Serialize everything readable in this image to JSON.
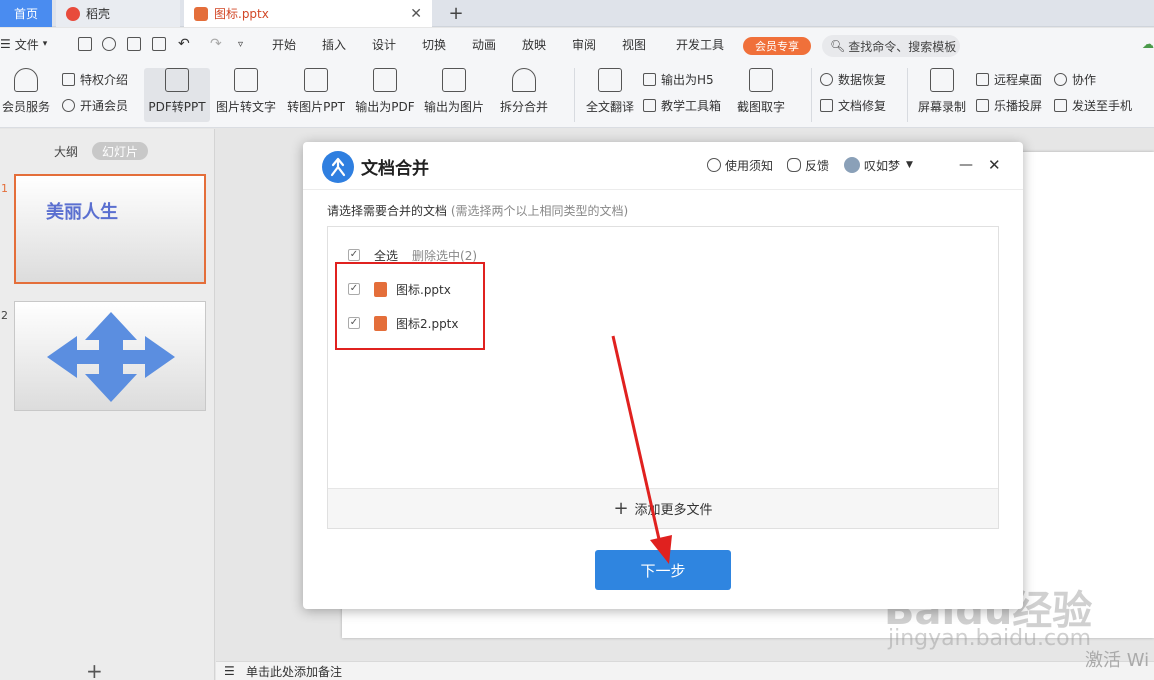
{
  "tabs": {
    "home": "首页",
    "daoke": "稻壳",
    "document": "图标.pptx"
  },
  "menu": {
    "file": "文件",
    "items": [
      "开始",
      "插入",
      "设计",
      "切换",
      "动画",
      "放映",
      "审阅",
      "视图",
      "开发工具"
    ],
    "vip": "会员专享",
    "search": "查找命令、搜索模板"
  },
  "ribbon": {
    "member_service": "会员服务",
    "privilege": "特权介绍",
    "open_member": "开通会员",
    "pdf_to_ppt": "PDF转PPT",
    "img_to_text": "图片转文字",
    "to_img_ppt": "转图片PPT",
    "export_pdf": "输出为PDF",
    "export_img": "输出为图片",
    "split_merge": "拆分合并",
    "full_translate": "全文翻译",
    "export_h5": "输出为H5",
    "teach_tools": "教学工具箱",
    "screenshot_text": "截图取字",
    "data_recover": "数据恢复",
    "doc_repair": "文档修复",
    "screen_record": "屏幕录制",
    "remote_desktop": "远程桌面",
    "cast": "乐播投屏",
    "collab": "协作",
    "send_phone": "发送至手机"
  },
  "left_panel": {
    "outline_tab": "大纲",
    "slides_tab": "幻灯片",
    "slides": [
      {
        "num": "1",
        "title": "美丽人生"
      },
      {
        "num": "2",
        "title": ""
      }
    ]
  },
  "notes_placeholder": "单击此处添加备注",
  "dialog": {
    "title": "文档合并",
    "help": "使用须知",
    "feedback": "反馈",
    "user": "叹如梦",
    "hint": "请选择需要合并的文档",
    "hint_sub": "(需选择两个以上相同类型的文档)",
    "select_all": "全选",
    "delete_selected": "删除选中(2)",
    "files": [
      "图标.pptx",
      "图标2.pptx"
    ],
    "add_more": "添加更多文件",
    "next": "下一步"
  },
  "watermark": {
    "brand": "Baidu经验",
    "url": "jingyan.baidu.com",
    "activate": "激活 Wi"
  },
  "colors": {
    "accent_blue": "#2f85e0",
    "ppt_orange": "#e46e3a",
    "annotation_red": "#e0211f"
  }
}
